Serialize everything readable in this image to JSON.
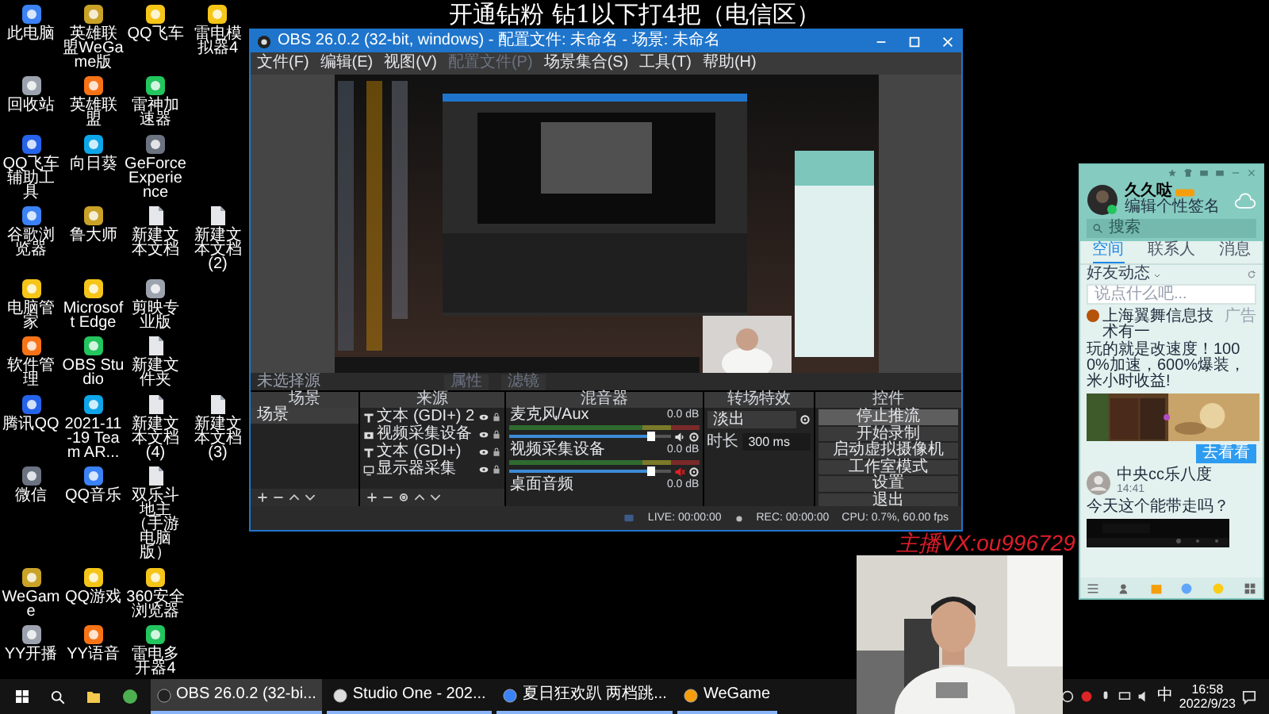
{
  "stream_overlay": {
    "title": "开通钻粉 钻1以下打4把（电信区）",
    "contact": "主播VX:ou996729"
  },
  "desktop_icons": [
    [
      {
        "label": "此电脑",
        "kind": "app"
      },
      {
        "label": "英雄联盟WeGame版",
        "kind": "app"
      },
      {
        "label": "QQ飞车",
        "kind": "app"
      },
      {
        "label": "雷电模拟器4",
        "kind": "app"
      }
    ],
    [
      {
        "label": "回收站",
        "kind": "app"
      },
      {
        "label": "英雄联盟",
        "kind": "app"
      },
      {
        "label": "雷神加速器",
        "kind": "app"
      }
    ],
    [
      {
        "label": "QQ飞车辅助工具",
        "kind": "app"
      },
      {
        "label": "向日葵",
        "kind": "app"
      },
      {
        "label": "GeForce Experience",
        "kind": "app"
      }
    ],
    [
      {
        "label": "谷歌浏览器",
        "kind": "app"
      },
      {
        "label": "鲁大师",
        "kind": "app"
      },
      {
        "label": "新建文本文档",
        "kind": "document"
      },
      {
        "label": "新建文本文档 (2)",
        "kind": "document"
      }
    ],
    [
      {
        "label": "电脑管家",
        "kind": "app"
      },
      {
        "label": "Microsoft Edge",
        "kind": "app"
      },
      {
        "label": "剪映专业版",
        "kind": "app"
      }
    ],
    [
      {
        "label": "软件管理",
        "kind": "app"
      },
      {
        "label": "OBS Studio",
        "kind": "app"
      },
      {
        "label": "新建文件夹",
        "kind": "document"
      }
    ],
    [
      {
        "label": "腾讯QQ",
        "kind": "app"
      },
      {
        "label": "2021-11-19 Team AR...",
        "kind": "app"
      },
      {
        "label": "新建文本文档 (4)",
        "kind": "document"
      },
      {
        "label": "新建文本文档 (3)",
        "kind": "document"
      }
    ],
    [
      {
        "label": "微信",
        "kind": "app"
      },
      {
        "label": "QQ音乐",
        "kind": "app"
      },
      {
        "label": "双乐斗地主（手游电脑版）",
        "kind": "document"
      }
    ],
    [
      {
        "label": "WeGame",
        "kind": "app"
      },
      {
        "label": "QQ游戏",
        "kind": "app"
      },
      {
        "label": "360安全浏览器",
        "kind": "app"
      }
    ],
    [
      {
        "label": "YY开播",
        "kind": "app"
      },
      {
        "label": "YY语音",
        "kind": "app"
      },
      {
        "label": "雷电多开器4",
        "kind": "app"
      }
    ]
  ],
  "obs": {
    "title": "OBS 26.0.2 (32-bit, windows) - 配置文件: 未命名 - 场景: 未命名",
    "menu": [
      {
        "label": "文件(F)",
        "disabled": false
      },
      {
        "label": "编辑(E)",
        "disabled": false
      },
      {
        "label": "视图(V)",
        "disabled": false
      },
      {
        "label": "配置文件(P)",
        "disabled": true
      },
      {
        "label": "场景集合(S)",
        "disabled": false
      },
      {
        "label": "工具(T)",
        "disabled": false
      },
      {
        "label": "帮助(H)",
        "disabled": false
      }
    ],
    "source_toolbar": {
      "label": "未选择源",
      "buttons": [
        "属性",
        "滤镜"
      ]
    },
    "scenes": {
      "title": "场景",
      "items": [
        {
          "label": "场景",
          "selected": true
        }
      ]
    },
    "sources": {
      "title": "来源",
      "items": [
        {
          "label": "文本 (GDI+) 2",
          "kind": "text"
        },
        {
          "label": "视频采集设备",
          "kind": "video"
        },
        {
          "label": "文本 (GDI+)",
          "kind": "text"
        },
        {
          "label": "显示器采集",
          "kind": "display"
        }
      ]
    },
    "mixer": {
      "title": "混音器",
      "channels": [
        {
          "name": "麦克风/Aux",
          "reading": "0.0 dB",
          "level": 0.88,
          "muted": false
        },
        {
          "name": "视频采集设备",
          "reading": "0.0 dB",
          "level": 0.88,
          "muted": true
        },
        {
          "name": "桌面音频",
          "reading": "0.0 dB"
        }
      ]
    },
    "transitions": {
      "title": "转场特效",
      "transition": "淡出",
      "duration_label": "时长",
      "duration": "300 ms"
    },
    "controls": {
      "title": "控件",
      "buttons": [
        {
          "label": "停止推流",
          "active": true
        },
        {
          "label": "开始录制",
          "active": false
        },
        {
          "label": "启动虚拟摄像机",
          "active": false
        },
        {
          "label": "工作室模式",
          "active": false
        },
        {
          "label": "设置",
          "active": false
        },
        {
          "label": "退出",
          "active": false
        }
      ]
    },
    "status_bar": {
      "live": "LIVE: 00:00:00",
      "rec": "REC: 00:00:00",
      "cpu": "CPU: 0.7%, 60.00 fps"
    }
  },
  "qq": {
    "name": "久久哒",
    "signature": "编辑个性签名",
    "search_placeholder": "搜索",
    "tabs": [
      {
        "label": "空间",
        "selected": true
      },
      {
        "label": "联系人",
        "selected": false
      },
      {
        "label": "消息",
        "selected": false
      }
    ],
    "feed_filter": "好友动态",
    "post_placeholder": "说点什么吧...",
    "ad": {
      "author": "上海翼舞信息技术有一",
      "tag": "广告",
      "text": "玩的就是改速度！1000%加速，600%爆装，米小时收益!",
      "button": "去看看"
    },
    "post": {
      "author": "中央cc乐八度",
      "time": "14:41",
      "text": "今天这个能带走吗？"
    }
  },
  "taskbar": {
    "apps": [
      {
        "label": "OBS 26.0.2 (32-bi...",
        "selected": true
      },
      {
        "label": "Studio One - 202...",
        "selected": false
      },
      {
        "label": "夏日狂欢趴 两档跳...",
        "selected": false
      },
      {
        "label": "WeGame",
        "selected": false
      }
    ],
    "ime": "中",
    "time": "16:58",
    "date": "2022/9/23"
  }
}
